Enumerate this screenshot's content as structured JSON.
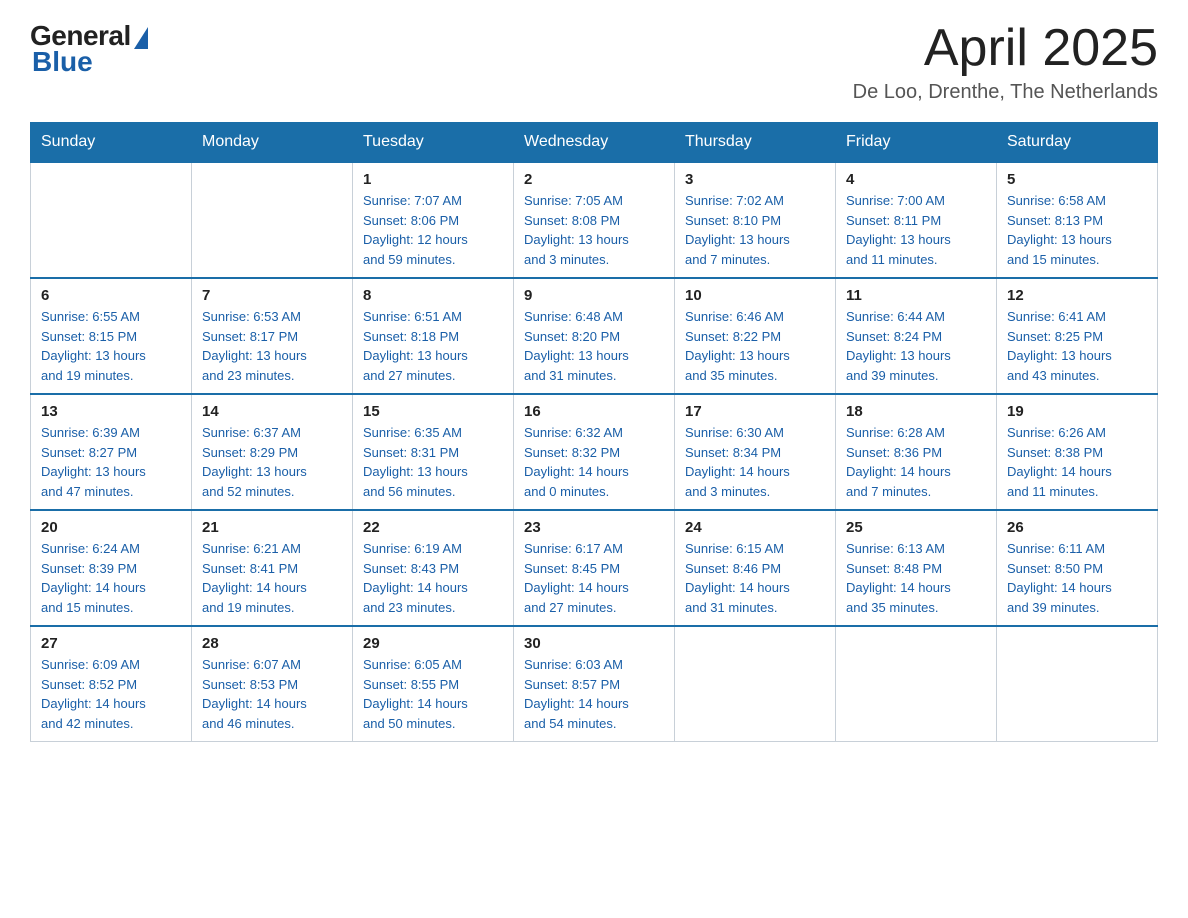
{
  "logo": {
    "general": "General",
    "blue": "Blue"
  },
  "title": "April 2025",
  "subtitle": "De Loo, Drenthe, The Netherlands",
  "days_of_week": [
    "Sunday",
    "Monday",
    "Tuesday",
    "Wednesday",
    "Thursday",
    "Friday",
    "Saturday"
  ],
  "weeks": [
    [
      {
        "day": "",
        "info": ""
      },
      {
        "day": "",
        "info": ""
      },
      {
        "day": "1",
        "info": "Sunrise: 7:07 AM\nSunset: 8:06 PM\nDaylight: 12 hours\nand 59 minutes."
      },
      {
        "day": "2",
        "info": "Sunrise: 7:05 AM\nSunset: 8:08 PM\nDaylight: 13 hours\nand 3 minutes."
      },
      {
        "day": "3",
        "info": "Sunrise: 7:02 AM\nSunset: 8:10 PM\nDaylight: 13 hours\nand 7 minutes."
      },
      {
        "day": "4",
        "info": "Sunrise: 7:00 AM\nSunset: 8:11 PM\nDaylight: 13 hours\nand 11 minutes."
      },
      {
        "day": "5",
        "info": "Sunrise: 6:58 AM\nSunset: 8:13 PM\nDaylight: 13 hours\nand 15 minutes."
      }
    ],
    [
      {
        "day": "6",
        "info": "Sunrise: 6:55 AM\nSunset: 8:15 PM\nDaylight: 13 hours\nand 19 minutes."
      },
      {
        "day": "7",
        "info": "Sunrise: 6:53 AM\nSunset: 8:17 PM\nDaylight: 13 hours\nand 23 minutes."
      },
      {
        "day": "8",
        "info": "Sunrise: 6:51 AM\nSunset: 8:18 PM\nDaylight: 13 hours\nand 27 minutes."
      },
      {
        "day": "9",
        "info": "Sunrise: 6:48 AM\nSunset: 8:20 PM\nDaylight: 13 hours\nand 31 minutes."
      },
      {
        "day": "10",
        "info": "Sunrise: 6:46 AM\nSunset: 8:22 PM\nDaylight: 13 hours\nand 35 minutes."
      },
      {
        "day": "11",
        "info": "Sunrise: 6:44 AM\nSunset: 8:24 PM\nDaylight: 13 hours\nand 39 minutes."
      },
      {
        "day": "12",
        "info": "Sunrise: 6:41 AM\nSunset: 8:25 PM\nDaylight: 13 hours\nand 43 minutes."
      }
    ],
    [
      {
        "day": "13",
        "info": "Sunrise: 6:39 AM\nSunset: 8:27 PM\nDaylight: 13 hours\nand 47 minutes."
      },
      {
        "day": "14",
        "info": "Sunrise: 6:37 AM\nSunset: 8:29 PM\nDaylight: 13 hours\nand 52 minutes."
      },
      {
        "day": "15",
        "info": "Sunrise: 6:35 AM\nSunset: 8:31 PM\nDaylight: 13 hours\nand 56 minutes."
      },
      {
        "day": "16",
        "info": "Sunrise: 6:32 AM\nSunset: 8:32 PM\nDaylight: 14 hours\nand 0 minutes."
      },
      {
        "day": "17",
        "info": "Sunrise: 6:30 AM\nSunset: 8:34 PM\nDaylight: 14 hours\nand 3 minutes."
      },
      {
        "day": "18",
        "info": "Sunrise: 6:28 AM\nSunset: 8:36 PM\nDaylight: 14 hours\nand 7 minutes."
      },
      {
        "day": "19",
        "info": "Sunrise: 6:26 AM\nSunset: 8:38 PM\nDaylight: 14 hours\nand 11 minutes."
      }
    ],
    [
      {
        "day": "20",
        "info": "Sunrise: 6:24 AM\nSunset: 8:39 PM\nDaylight: 14 hours\nand 15 minutes."
      },
      {
        "day": "21",
        "info": "Sunrise: 6:21 AM\nSunset: 8:41 PM\nDaylight: 14 hours\nand 19 minutes."
      },
      {
        "day": "22",
        "info": "Sunrise: 6:19 AM\nSunset: 8:43 PM\nDaylight: 14 hours\nand 23 minutes."
      },
      {
        "day": "23",
        "info": "Sunrise: 6:17 AM\nSunset: 8:45 PM\nDaylight: 14 hours\nand 27 minutes."
      },
      {
        "day": "24",
        "info": "Sunrise: 6:15 AM\nSunset: 8:46 PM\nDaylight: 14 hours\nand 31 minutes."
      },
      {
        "day": "25",
        "info": "Sunrise: 6:13 AM\nSunset: 8:48 PM\nDaylight: 14 hours\nand 35 minutes."
      },
      {
        "day": "26",
        "info": "Sunrise: 6:11 AM\nSunset: 8:50 PM\nDaylight: 14 hours\nand 39 minutes."
      }
    ],
    [
      {
        "day": "27",
        "info": "Sunrise: 6:09 AM\nSunset: 8:52 PM\nDaylight: 14 hours\nand 42 minutes."
      },
      {
        "day": "28",
        "info": "Sunrise: 6:07 AM\nSunset: 8:53 PM\nDaylight: 14 hours\nand 46 minutes."
      },
      {
        "day": "29",
        "info": "Sunrise: 6:05 AM\nSunset: 8:55 PM\nDaylight: 14 hours\nand 50 minutes."
      },
      {
        "day": "30",
        "info": "Sunrise: 6:03 AM\nSunset: 8:57 PM\nDaylight: 14 hours\nand 54 minutes."
      },
      {
        "day": "",
        "info": ""
      },
      {
        "day": "",
        "info": ""
      },
      {
        "day": "",
        "info": ""
      }
    ]
  ]
}
